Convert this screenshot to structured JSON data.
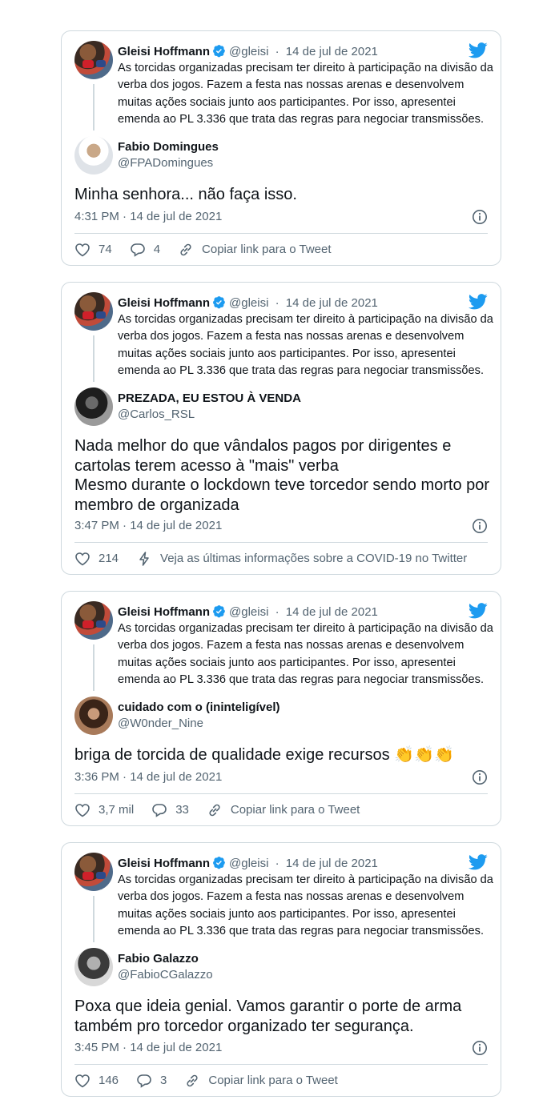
{
  "quoted": {
    "name": "Gleisi Hoffmann",
    "handle": "@gleisi",
    "sep": "·",
    "date": "14 de jul de 2021",
    "text": "As torcidas organizadas precisam ter direito à participação na divisão da verba dos jogos. Fazem a festa nas nossas arenas e desenvolvem muitas ações sociais junto aos participantes. Por isso, apresentei emenda ao PL 3.336 que trata das regras para negociar transmissões."
  },
  "cards": [
    {
      "reply_name": "Fabio Domingues",
      "reply_handle": "@FPADomingues",
      "reply_text": "Minha senhora... não faça isso.",
      "timestamp": "4:31 PM · 14 de jul de 2021",
      "likes": "74",
      "replies": "4",
      "third_action": "Copiar link para o Tweet"
    },
    {
      "reply_name": "PREZADA, EU ESTOU À VENDA",
      "reply_handle": "@Carlos_RSL",
      "reply_text": "Nada melhor do que vândalos pagos por dirigentes e cartolas terem acesso à \"mais\" verba\nMesmo durante o lockdown teve torcedor sendo morto por membro de organizada",
      "timestamp": "3:47 PM · 14 de jul de 2021",
      "likes": "214",
      "third_action": "Veja as últimas informações sobre a COVID-19 no Twitter"
    },
    {
      "reply_name": "cuidado com o (ininteligível)",
      "reply_handle": "@W0nder_Nine",
      "reply_text": "briga de torcida de qualidade exige recursos",
      "reply_emoji": "👏👏👏",
      "timestamp": "3:36 PM · 14 de jul de 2021",
      "likes": "3,7 mil",
      "replies": "33",
      "third_action": "Copiar link para o Tweet"
    },
    {
      "reply_name": "Fabio Galazzo",
      "reply_handle": "@FabioCGalazzo",
      "reply_text": "Poxa que ideia genial. Vamos garantir o porte de arma também pro torcedor organizado ter segurança.",
      "timestamp": "3:45 PM · 14 de jul de 2021",
      "likes": "146",
      "replies": "3",
      "third_action": "Copiar link para o Tweet"
    }
  ],
  "colors": {
    "accent": "#1d9bf0",
    "secondary_text": "#536471",
    "border": "#cfd9de"
  },
  "icons": [
    "verified-badge-icon",
    "twitter-bird-icon",
    "info-icon",
    "heart-icon",
    "reply-bubble-icon",
    "link-icon",
    "bolt-icon"
  ]
}
